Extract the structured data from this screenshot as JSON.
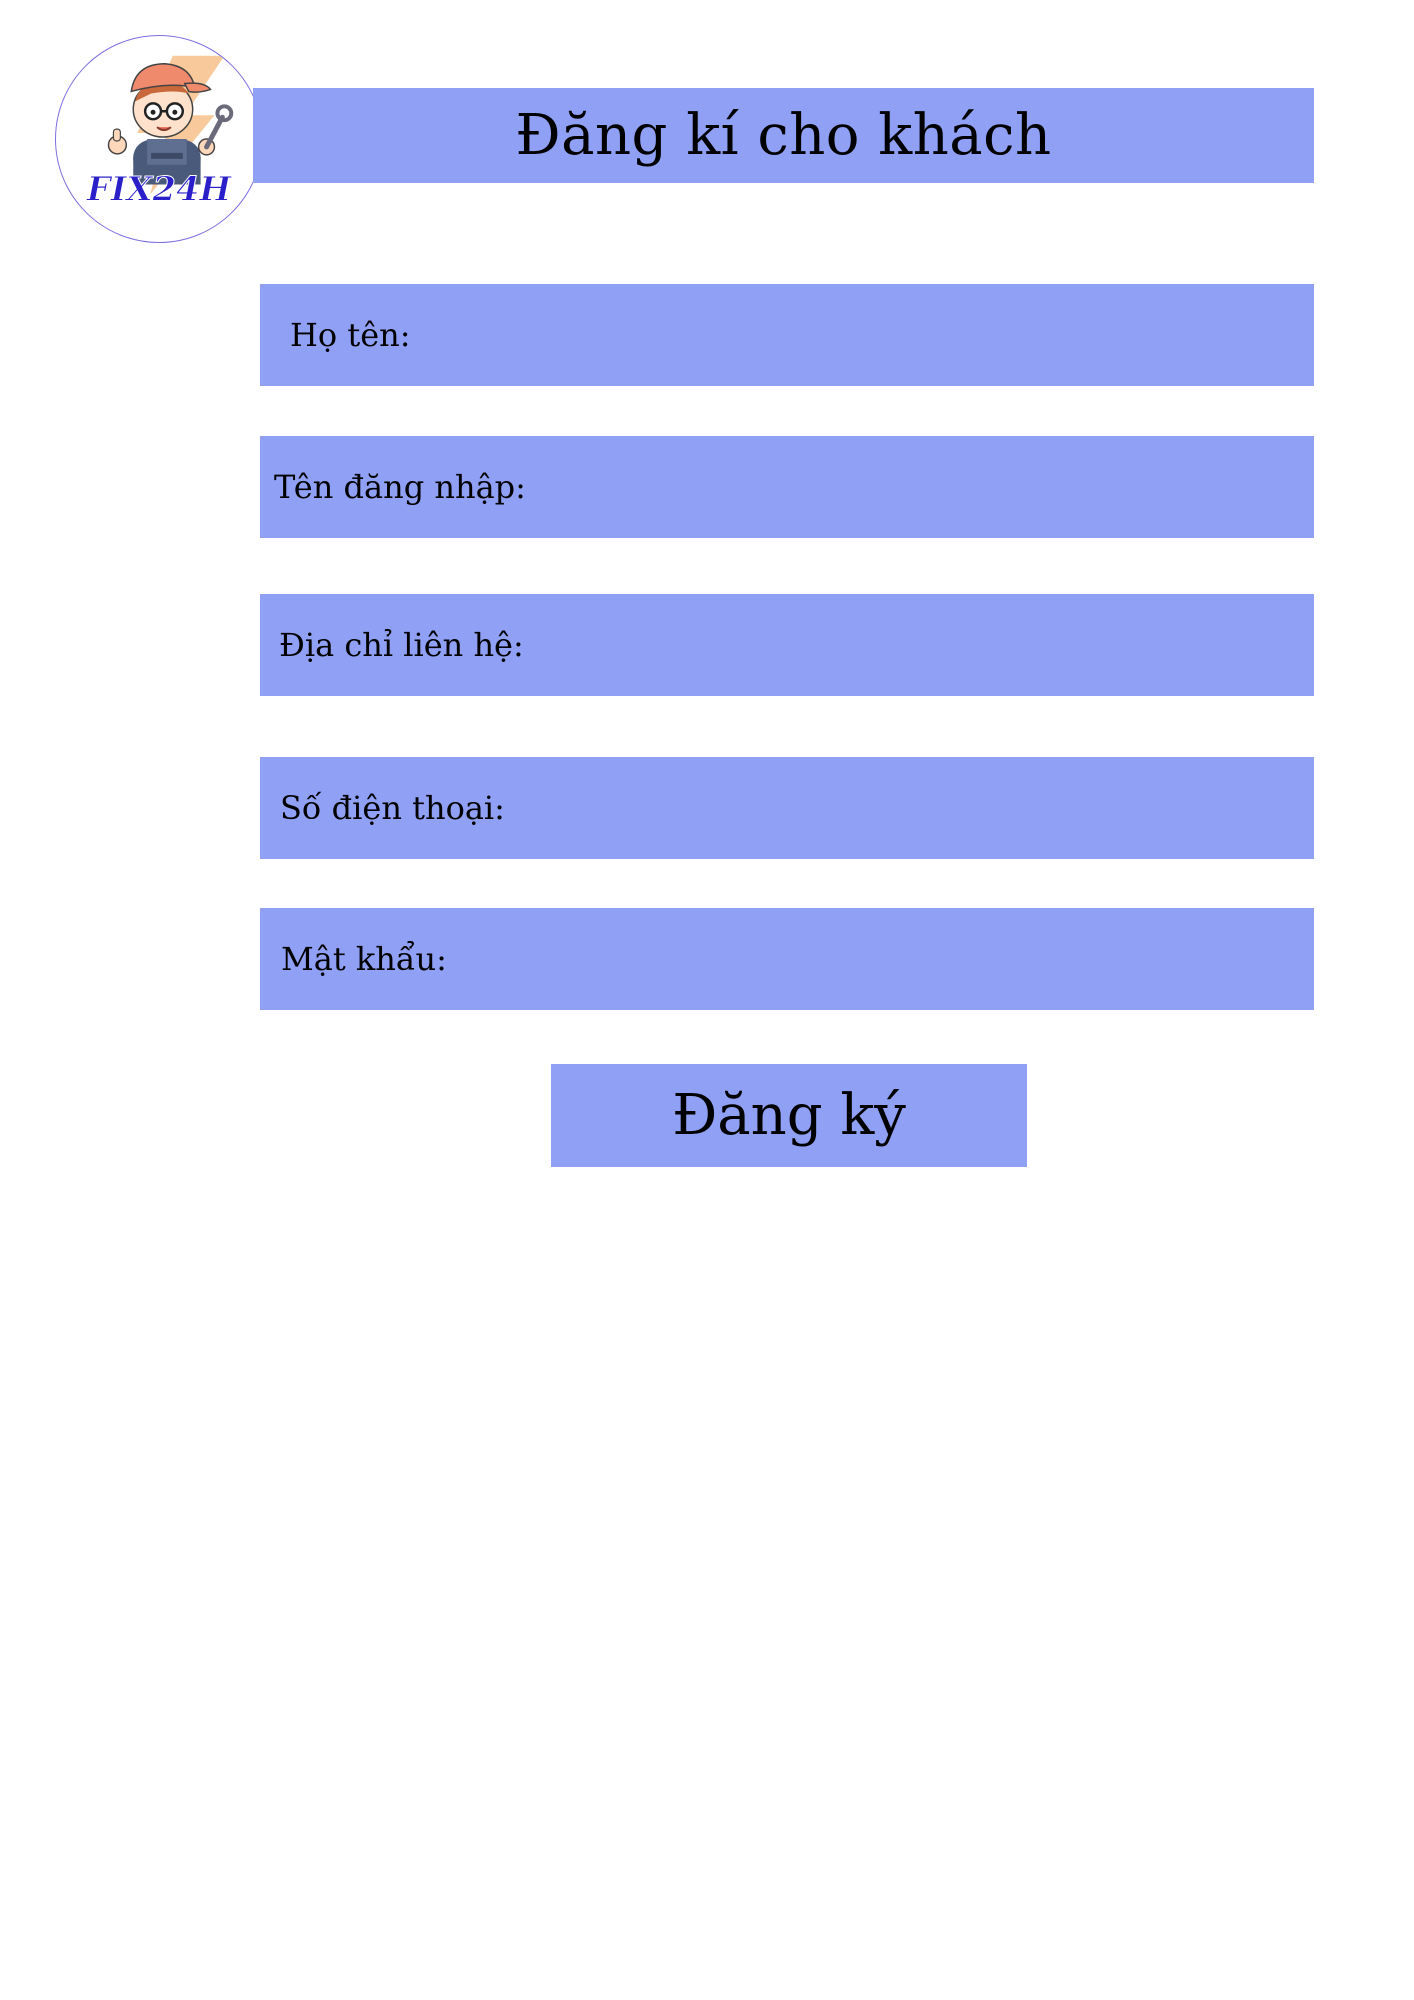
{
  "logo": {
    "text": "FIX24H",
    "icon": "mechanic-mascot-icon",
    "colors": {
      "ring": "#7b6fe0",
      "text": "#2a1fc9",
      "bolt": "#f7c08a",
      "cap": "#f08a6c",
      "overalls": "#4a5a7a"
    }
  },
  "header": {
    "title": "Đăng kí cho khách"
  },
  "form": {
    "fields": [
      {
        "label": "Họ tên:",
        "value": ""
      },
      {
        "label": "Tên đăng nhập:",
        "value": ""
      },
      {
        "label": "Địa chỉ liên hệ:",
        "value": ""
      },
      {
        "label": "Số điện thoại:",
        "value": ""
      },
      {
        "label": "Mật khẩu:",
        "value": ""
      }
    ],
    "submit_label": "Đăng ký"
  },
  "theme": {
    "accent": "#90a0f4",
    "background": "#ffffff",
    "text": "#000000"
  }
}
